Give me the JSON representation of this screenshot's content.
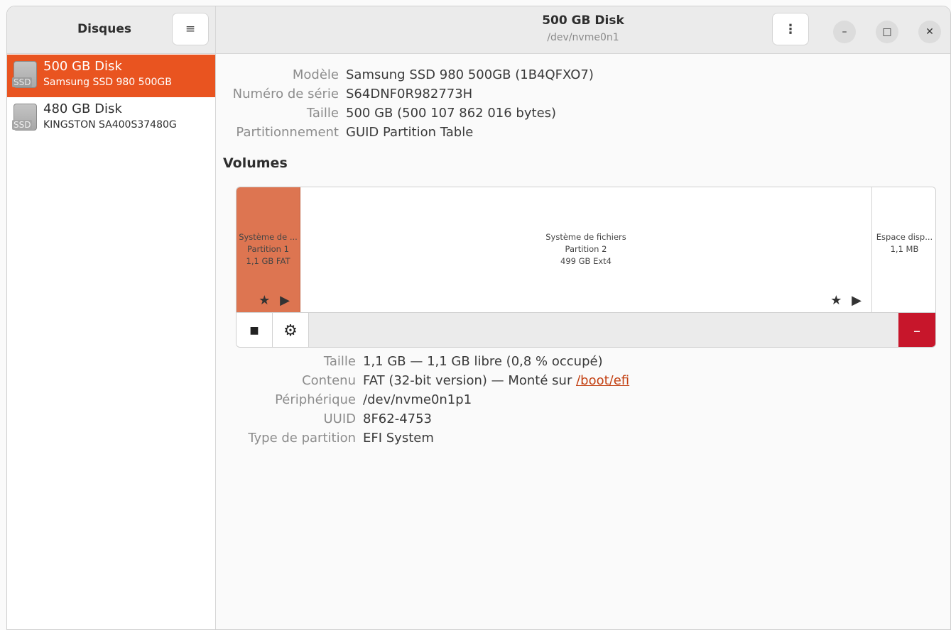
{
  "sidebar": {
    "title": "Disques",
    "disks": [
      {
        "name": "500 GB Disk",
        "model": "Samsung SSD 980 500GB",
        "icon_label": "SSD"
      },
      {
        "name": "480 GB Disk",
        "model": "KINGSTON SA400S37480G",
        "icon_label": "SSD"
      }
    ]
  },
  "header": {
    "title": "500 GB Disk",
    "subtitle": "/dev/nvme0n1",
    "menu_icon": "≡",
    "kebab_icon": "⋮",
    "window_controls": [
      "–",
      "□",
      "✕"
    ]
  },
  "disk_info": {
    "model_key": "Modèle",
    "model_val": "Samsung SSD 980 500GB (1B4QFXO7)",
    "serial_key": "Numéro de série",
    "serial_val": "S64DNF0R982773H",
    "size_key": "Taille",
    "size_val": "500 GB (500 107 862 016 bytes)",
    "partitioning_key": "Partitionnement",
    "partitioning_val": "GUID Partition Table"
  },
  "volumes": {
    "title": "Volumes",
    "partitions": [
      {
        "line1": "Système de ...",
        "line2": "Partition 1",
        "line3": "1,1 GB FAT",
        "icons": "★ ▶"
      },
      {
        "line1": "Système de fichiers",
        "line2": "Partition 2",
        "line3": "499 GB Ext4",
        "icons": "★ ▶"
      },
      {
        "line1": "Espace disp...",
        "line2": "1,1 MB",
        "line3": ""
      }
    ],
    "toolbar": {
      "stop_icon": "■",
      "gear_icon": "⚙",
      "delete_icon": "–"
    }
  },
  "partition_info": {
    "size_key": "Taille",
    "size_val": "1,1 GB — 1,1 GB libre (0,8 % occupé)",
    "content_key": "Contenu",
    "content_val": "FAT (32-bit version) — Monté sur ",
    "content_link": "/boot/efi",
    "device_key": "Périphérique",
    "device_val": "/dev/nvme0n1p1",
    "uuid_key": "UUID",
    "uuid_val": "8F62-4753",
    "type_key": "Type de partition",
    "type_val": "EFI System"
  },
  "colors": {
    "accent": "#e95420",
    "partition_selected": "#dd7551",
    "danger": "#c7162b"
  }
}
